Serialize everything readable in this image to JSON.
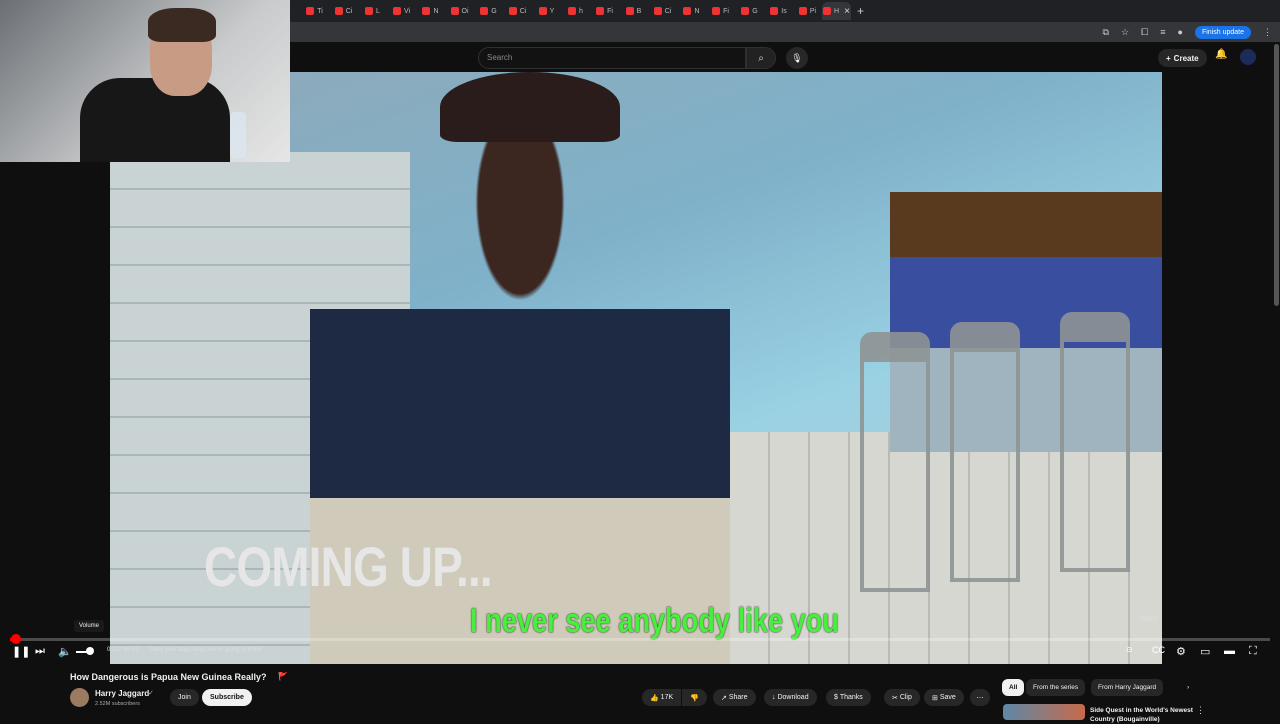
{
  "browser": {
    "active_tab_label": "H",
    "tab_labels": [
      "Ti",
      "Ci",
      "L",
      "Vi",
      "N",
      "Oi",
      "G",
      "Ci",
      "Y",
      "h",
      "Fi",
      "B",
      "Ci",
      "N",
      "Fi",
      "G",
      "Is",
      "Pi"
    ],
    "finish_update": "Finish update"
  },
  "topbar": {
    "search_placeholder": "Search",
    "create_label": "Create"
  },
  "video": {
    "overlay_title": "COMING UP...",
    "subtitle": "I never see anybody like you",
    "watermark": "Harry",
    "progress_fraction": 0.0044
  },
  "player": {
    "time": "0:13 / 49:52",
    "chapter": "Pack your bags boys, we're going to PNG!",
    "tooltip": "Volume",
    "volume_fraction": 0.6
  },
  "meta": {
    "title": "How Dangerous is Papua New Guinea Really?",
    "title_emoji": "🚩",
    "channel": "Harry Jaggard",
    "subscribers": "2.52M subscribers",
    "join": "Join",
    "subscribe": "Subscribe",
    "likes": "17K",
    "share": "Share",
    "download": "Download",
    "thanks": "Thanks",
    "clip": "Clip",
    "save": "Save"
  },
  "chips": [
    "All",
    "From the series",
    "From Harry Jaggard"
  ],
  "recommendation": {
    "title": "Side Quest in the World's Newest Country (Bougainville)"
  },
  "colors": {
    "accent": "#ff0000",
    "subtitle_green": "#46f03c",
    "brand_blue": "#1a73e8"
  }
}
